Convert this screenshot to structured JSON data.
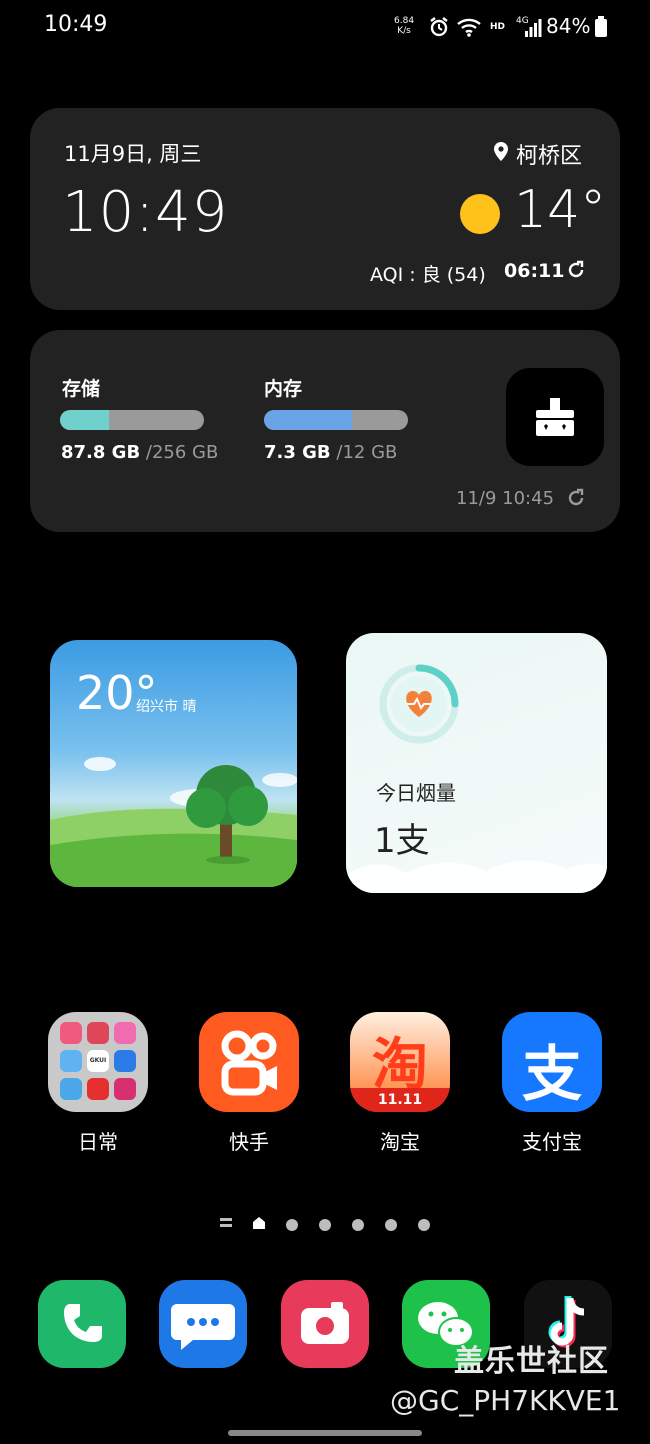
{
  "status_bar": {
    "time": "10:49",
    "net_speed_value": "6.84",
    "net_speed_unit": "K/s",
    "hd_label": "HD",
    "network_label": "4G",
    "battery": "84%"
  },
  "clock_widget": {
    "date": "11月9日, 周三",
    "time": "10:49",
    "location": "柯桥区",
    "temperature": "14°",
    "aqi": "AQI : 良 (54)",
    "updated": "06:11"
  },
  "storage_widget": {
    "storage_label": "存储",
    "storage_used": "87.8 GB",
    "storage_total": "/256 GB",
    "storage_fraction": 0.343,
    "memory_label": "内存",
    "memory_used": "7.3 GB",
    "memory_total": "/12 GB",
    "memory_fraction": 0.608,
    "updated": "11/9 10:45"
  },
  "weather_widget": {
    "temperature": "20°",
    "location": "绍兴市 晴"
  },
  "smoke_widget": {
    "label": "今日烟量",
    "count": "1支"
  },
  "apps": [
    {
      "label": "日常",
      "icon": "folder-icon"
    },
    {
      "label": "快手",
      "icon": "kuaishou-icon"
    },
    {
      "label": "淘宝",
      "icon": "taobao-icon",
      "badge": "11.11",
      "glyph": "淘"
    },
    {
      "label": "支付宝",
      "icon": "alipay-icon",
      "glyph": "支"
    }
  ],
  "folder_mini_label": "GKUI",
  "dock": [
    "phone-icon",
    "messages-icon",
    "camera-icon",
    "wechat-icon",
    "tiktok-icon"
  ],
  "watermark": {
    "brand": "盖乐世社区",
    "user": "@GC_PH7KKVE1"
  },
  "colors": {
    "storage_bar": "#6fd0cc",
    "memory_bar": "#6aa3e6",
    "sun": "#ffc21a",
    "kuaishou": "#ff5a1f",
    "alipay": "#1677ff"
  }
}
